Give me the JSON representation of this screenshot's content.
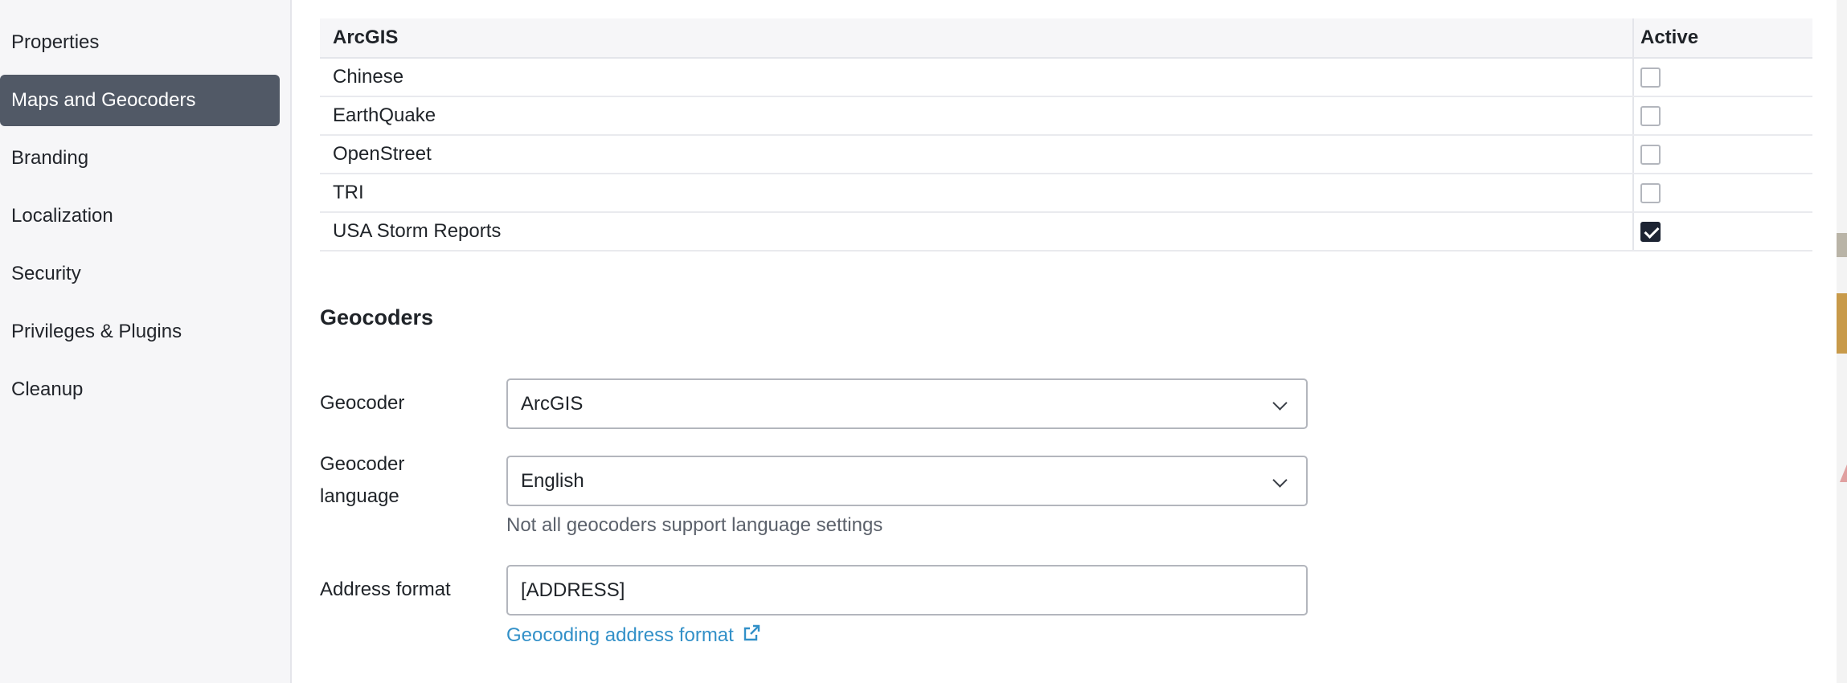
{
  "sidebar": {
    "items": [
      {
        "label": "Properties",
        "active": false
      },
      {
        "label": "Maps and Geocoders",
        "active": true
      },
      {
        "label": "Branding",
        "active": false
      },
      {
        "label": "Localization",
        "active": false
      },
      {
        "label": "Security",
        "active": false
      },
      {
        "label": "Privileges & Plugins",
        "active": false
      },
      {
        "label": "Cleanup",
        "active": false
      }
    ]
  },
  "maps_table": {
    "header": {
      "name": "ArcGIS",
      "active": "Active"
    },
    "rows": [
      {
        "name": "Chinese",
        "active": false
      },
      {
        "name": "EarthQuake",
        "active": false
      },
      {
        "name": "OpenStreet",
        "active": false
      },
      {
        "name": "TRI",
        "active": false
      },
      {
        "name": "USA Storm Reports",
        "active": true
      }
    ]
  },
  "geocoders": {
    "title": "Geocoders",
    "geocoder_label": "Geocoder",
    "geocoder_value": "ArcGIS",
    "language_label": "Geocoder language",
    "language_value": "English",
    "language_help": "Not all geocoders support language settings",
    "address_label": "Address format",
    "address_value": "[ADDRESS]",
    "address_link": "Geocoding address format"
  },
  "colors": {
    "active_nav": "#515966",
    "link": "#3290c8",
    "checkbox_checked": "#1d2433"
  }
}
